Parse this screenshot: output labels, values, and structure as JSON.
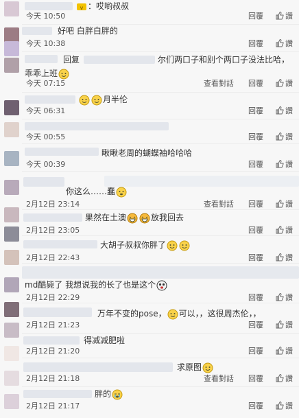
{
  "actions": {
    "reply": "回覆",
    "view_conversation": "查看對話",
    "like": "讚"
  },
  "avatar_colors": [
    "#d8c8d4",
    "#9c7c84",
    "#c7b9d9",
    "#b0a0a8",
    "#6f6070",
    "#e0d2cc",
    "#a8b4c2",
    "#b8aaba",
    "#c9b8be",
    "#8c8c98",
    "#d4c2ba",
    "#b1a6b8",
    "#806e78",
    "#c8bcc6",
    "#f0e7e4",
    "#e5dce0",
    "#dcd0da"
  ],
  "comments": [
    {
      "text": "：哎哟叔叔",
      "time": "今天 10:50",
      "has_view": false
    },
    {
      "text": "好吧 白胖白胖的",
      "time": "今天 10:38",
      "has_view": false
    },
    {
      "text": "回复",
      "text2": "尔们两口子和别个两口子没法比哈，",
      "text3": "乖乖上班",
      "time": "今天 07:15",
      "has_view": true
    },
    {
      "text": "月半伦",
      "time": "今天 06:31",
      "has_view": false
    },
    {
      "text": "",
      "time": "今天 00:55",
      "has_view": false
    },
    {
      "text": "瞅瞅老周的蝴蝶袖哈哈哈",
      "time": "今天 00:39",
      "has_view": false
    },
    {
      "text": "你这么……蠢",
      "time": "2月12日 23:14",
      "has_view": true
    },
    {
      "text": "果然在土澳",
      "text2": "放我回去",
      "time": "2月12日 23:05",
      "has_view": false
    },
    {
      "text": "大胡子叔叔你胖了",
      "time": "2月12日 22:43",
      "has_view": false
    },
    {
      "text": "md酷毙了 我想说我的长了也是这个",
      "time": "2月12日 22:29",
      "has_view": false
    },
    {
      "text": "万年不变的pose，",
      "text2": "可以，，这很周杰伦，，",
      "time": "2月12日 21:23",
      "has_view": false
    },
    {
      "text": "得减减肥啦",
      "time": "2月12日 21:20",
      "has_view": false
    },
    {
      "text": "求原图",
      "time": "2月12日 21:18",
      "has_view": true
    },
    {
      "text": "胖的",
      "time": "2月12日 21:17",
      "has_view": false
    }
  ]
}
